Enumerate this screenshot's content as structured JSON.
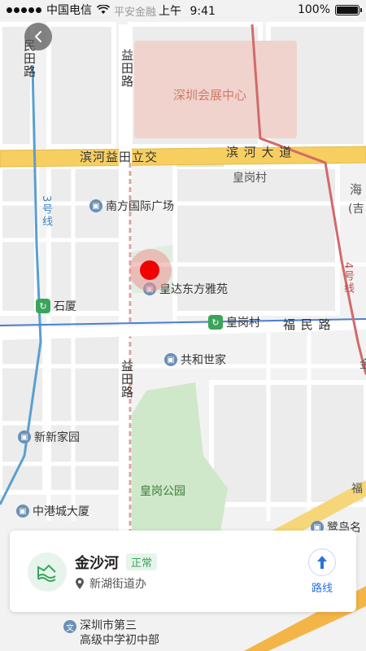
{
  "status_bar": {
    "carrier": "中国电信",
    "time_period": "上午",
    "time": "9:41",
    "battery": "100%",
    "battery_level": 1.0,
    "wifi_icon": "wifi-icon"
  },
  "map": {
    "back_icon": "chevron-left-icon",
    "road_labels": {
      "binhe_yitian": "滨河益田立交",
      "binhe_dadao": "滨 河 大 道",
      "yitian_top": "益田路",
      "yitian_mid": "益田路",
      "min_tian": "民田路",
      "fumin": "福 民 路",
      "line3": "3号线",
      "line4": "4号线",
      "hai": "海",
      "ji": "(吉",
      "fu": "福",
      "jin": "金"
    },
    "areas": {
      "expo": "深圳会展中心",
      "park": "皇岗公园",
      "huanggang_village": "皇岗村"
    },
    "pois": {
      "nanfang": "南方国际广场",
      "huangda": "皇达东方雅苑",
      "gonghe": "共和世家",
      "xinxin": "新新家园",
      "zhonggang": "中港城大厦",
      "luhuang": "鹭鸟名",
      "school_line1": "深圳市第三",
      "school_line2": "高级中学初中部",
      "ping_an": "平安金融"
    },
    "metro_stations": {
      "shixia": "石厦",
      "huanggang": "皇岗村"
    },
    "metro_icon": "metro-icon",
    "poi_icon": "building-icon",
    "school_icon": "school-icon",
    "marker_color": "#f00000"
  },
  "info_card": {
    "place_name": "金沙河",
    "status": "正常",
    "location": "新湖街道办",
    "route_label": "路线",
    "river_icon": "river-icon",
    "location_icon": "location-pin-icon",
    "route_icon": "navigation-arrow-icon",
    "accent": "#2a72d8",
    "status_color": "#3aa55a"
  }
}
